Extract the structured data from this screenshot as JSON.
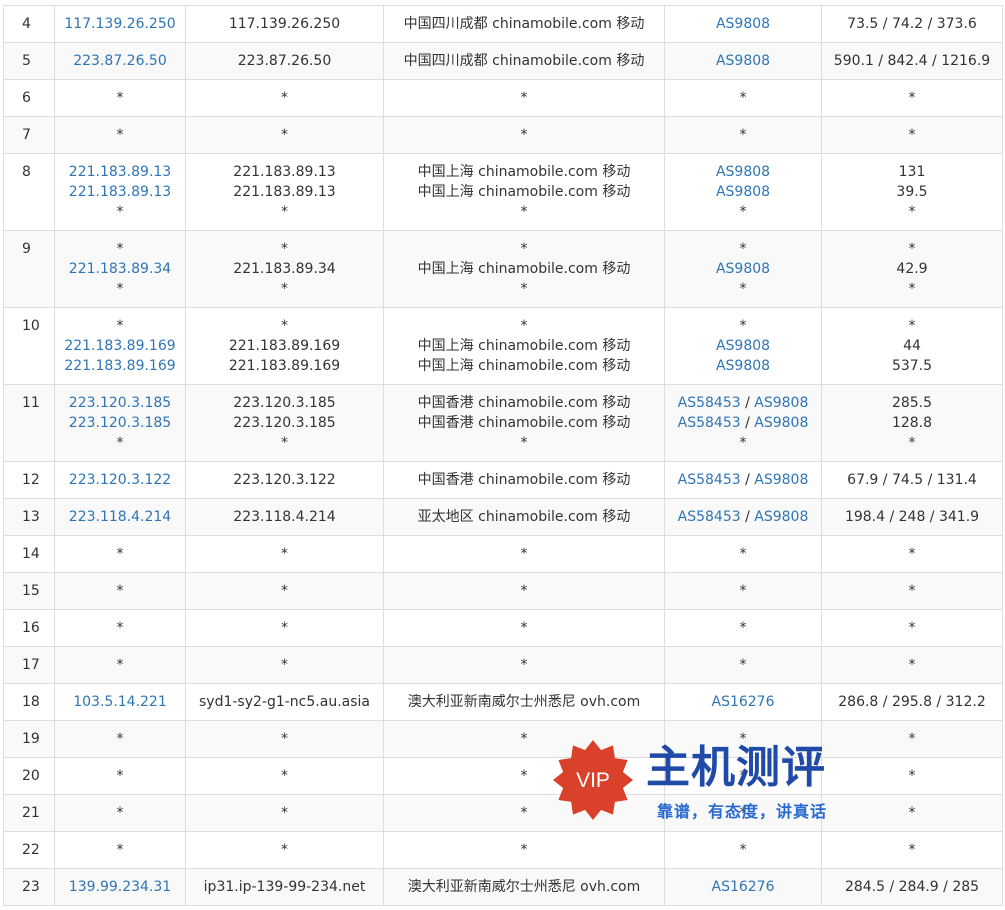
{
  "trace_rows": [
    {
      "hop": "4",
      "lines": [
        {
          "ip": "117.139.26.250",
          "host": "117.139.26.250",
          "geo": "中国四川成都 chinamobile.com 移动",
          "as": [
            "AS9808"
          ]
        }
      ],
      "latency": [
        "73.5 / 74.2 / 373.6"
      ]
    },
    {
      "hop": "5",
      "lines": [
        {
          "ip": "223.87.26.50",
          "host": "223.87.26.50",
          "geo": "中国四川成都 chinamobile.com 移动",
          "as": [
            "AS9808"
          ]
        }
      ],
      "latency": [
        "590.1 / 842.4 / 1216.9"
      ]
    },
    {
      "hop": "6",
      "lines": [
        {
          "ip": "*",
          "host": "*",
          "geo": "*",
          "as": [
            "*"
          ]
        }
      ],
      "latency": [
        "*"
      ]
    },
    {
      "hop": "7",
      "lines": [
        {
          "ip": "*",
          "host": "*",
          "geo": "*",
          "as": [
            "*"
          ]
        }
      ],
      "latency": [
        "*"
      ]
    },
    {
      "hop": "8",
      "lines": [
        {
          "ip": "221.183.89.13",
          "host": "221.183.89.13",
          "geo": "中国上海 chinamobile.com 移动",
          "as": [
            "AS9808"
          ]
        },
        {
          "ip": "221.183.89.13",
          "host": "221.183.89.13",
          "geo": "中国上海 chinamobile.com 移动",
          "as": [
            "AS9808"
          ]
        },
        {
          "ip": "*",
          "host": "*",
          "geo": "*",
          "as": [
            "*"
          ]
        }
      ],
      "latency": [
        "131",
        "39.5",
        "*"
      ]
    },
    {
      "hop": "9",
      "lines": [
        {
          "ip": "*",
          "host": "*",
          "geo": "*",
          "as": [
            "*"
          ]
        },
        {
          "ip": "221.183.89.34",
          "host": "221.183.89.34",
          "geo": "中国上海 chinamobile.com 移动",
          "as": [
            "AS9808"
          ]
        },
        {
          "ip": "*",
          "host": "*",
          "geo": "*",
          "as": [
            "*"
          ]
        }
      ],
      "latency": [
        "*",
        "42.9",
        "*"
      ]
    },
    {
      "hop": "10",
      "lines": [
        {
          "ip": "*",
          "host": "*",
          "geo": "*",
          "as": [
            "*"
          ]
        },
        {
          "ip": "221.183.89.169",
          "host": "221.183.89.169",
          "geo": "中国上海 chinamobile.com 移动",
          "as": [
            "AS9808"
          ]
        },
        {
          "ip": "221.183.89.169",
          "host": "221.183.89.169",
          "geo": "中国上海 chinamobile.com 移动",
          "as": [
            "AS9808"
          ]
        }
      ],
      "latency": [
        "*",
        "44",
        "537.5"
      ]
    },
    {
      "hop": "11",
      "lines": [
        {
          "ip": "223.120.3.185",
          "host": "223.120.3.185",
          "geo": "中国香港 chinamobile.com 移动",
          "as": [
            "AS58453",
            "AS9808"
          ]
        },
        {
          "ip": "223.120.3.185",
          "host": "223.120.3.185",
          "geo": "中国香港 chinamobile.com 移动",
          "as": [
            "AS58453",
            "AS9808"
          ]
        },
        {
          "ip": "*",
          "host": "*",
          "geo": "*",
          "as": [
            "*"
          ]
        }
      ],
      "latency": [
        "285.5",
        "128.8",
        "*"
      ]
    },
    {
      "hop": "12",
      "lines": [
        {
          "ip": "223.120.3.122",
          "host": "223.120.3.122",
          "geo": "中国香港 chinamobile.com 移动",
          "as": [
            "AS58453",
            "AS9808"
          ]
        }
      ],
      "latency": [
        "67.9 / 74.5 / 131.4"
      ]
    },
    {
      "hop": "13",
      "lines": [
        {
          "ip": "223.118.4.214",
          "host": "223.118.4.214",
          "geo": "亚太地区 chinamobile.com 移动",
          "as": [
            "AS58453",
            "AS9808"
          ]
        }
      ],
      "latency": [
        "198.4 / 248 / 341.9"
      ]
    },
    {
      "hop": "14",
      "lines": [
        {
          "ip": "*",
          "host": "*",
          "geo": "*",
          "as": [
            "*"
          ]
        }
      ],
      "latency": [
        "*"
      ]
    },
    {
      "hop": "15",
      "lines": [
        {
          "ip": "*",
          "host": "*",
          "geo": "*",
          "as": [
            "*"
          ]
        }
      ],
      "latency": [
        "*"
      ]
    },
    {
      "hop": "16",
      "lines": [
        {
          "ip": "*",
          "host": "*",
          "geo": "*",
          "as": [
            "*"
          ]
        }
      ],
      "latency": [
        "*"
      ]
    },
    {
      "hop": "17",
      "lines": [
        {
          "ip": "*",
          "host": "*",
          "geo": "*",
          "as": [
            "*"
          ]
        }
      ],
      "latency": [
        "*"
      ]
    },
    {
      "hop": "18",
      "lines": [
        {
          "ip": "103.5.14.221",
          "host": "syd1-sy2-g1-nc5.au.asia",
          "geo": "澳大利亚新南威尔士州悉尼 ovh.com",
          "as": [
            "AS16276"
          ]
        }
      ],
      "latency": [
        "286.8 / 295.8 / 312.2"
      ]
    },
    {
      "hop": "19",
      "lines": [
        {
          "ip": "*",
          "host": "*",
          "geo": "*",
          "as": [
            "*"
          ]
        }
      ],
      "latency": [
        "*"
      ]
    },
    {
      "hop": "20",
      "lines": [
        {
          "ip": "*",
          "host": "*",
          "geo": "*",
          "as": [
            "*"
          ]
        }
      ],
      "latency": [
        "*"
      ]
    },
    {
      "hop": "21",
      "lines": [
        {
          "ip": "*",
          "host": "*",
          "geo": "*",
          "as": [
            "*"
          ]
        }
      ],
      "latency": [
        "*"
      ]
    },
    {
      "hop": "22",
      "lines": [
        {
          "ip": "*",
          "host": "*",
          "geo": "*",
          "as": [
            "*"
          ]
        }
      ],
      "latency": [
        "*"
      ]
    },
    {
      "hop": "23",
      "lines": [
        {
          "ip": "139.99.234.31",
          "host": "ip31.ip-139-99-234.net",
          "geo": "澳大利亚新南威尔士州悉尼 ovh.com",
          "as": [
            "AS16276"
          ]
        }
      ],
      "latency": [
        "284.5 / 284.9 / 285"
      ]
    }
  ],
  "colors": {
    "link": "#2f75b5",
    "text": "#333333",
    "border": "#dddddd",
    "stripe": "#f9f9f9",
    "watermark_badge": "#d9412b",
    "watermark_title": "#1f4aa8"
  },
  "watermark": {
    "badge": "VIP",
    "title": "主机测评",
    "subtitle": "靠谱，有态度，讲真话"
  }
}
